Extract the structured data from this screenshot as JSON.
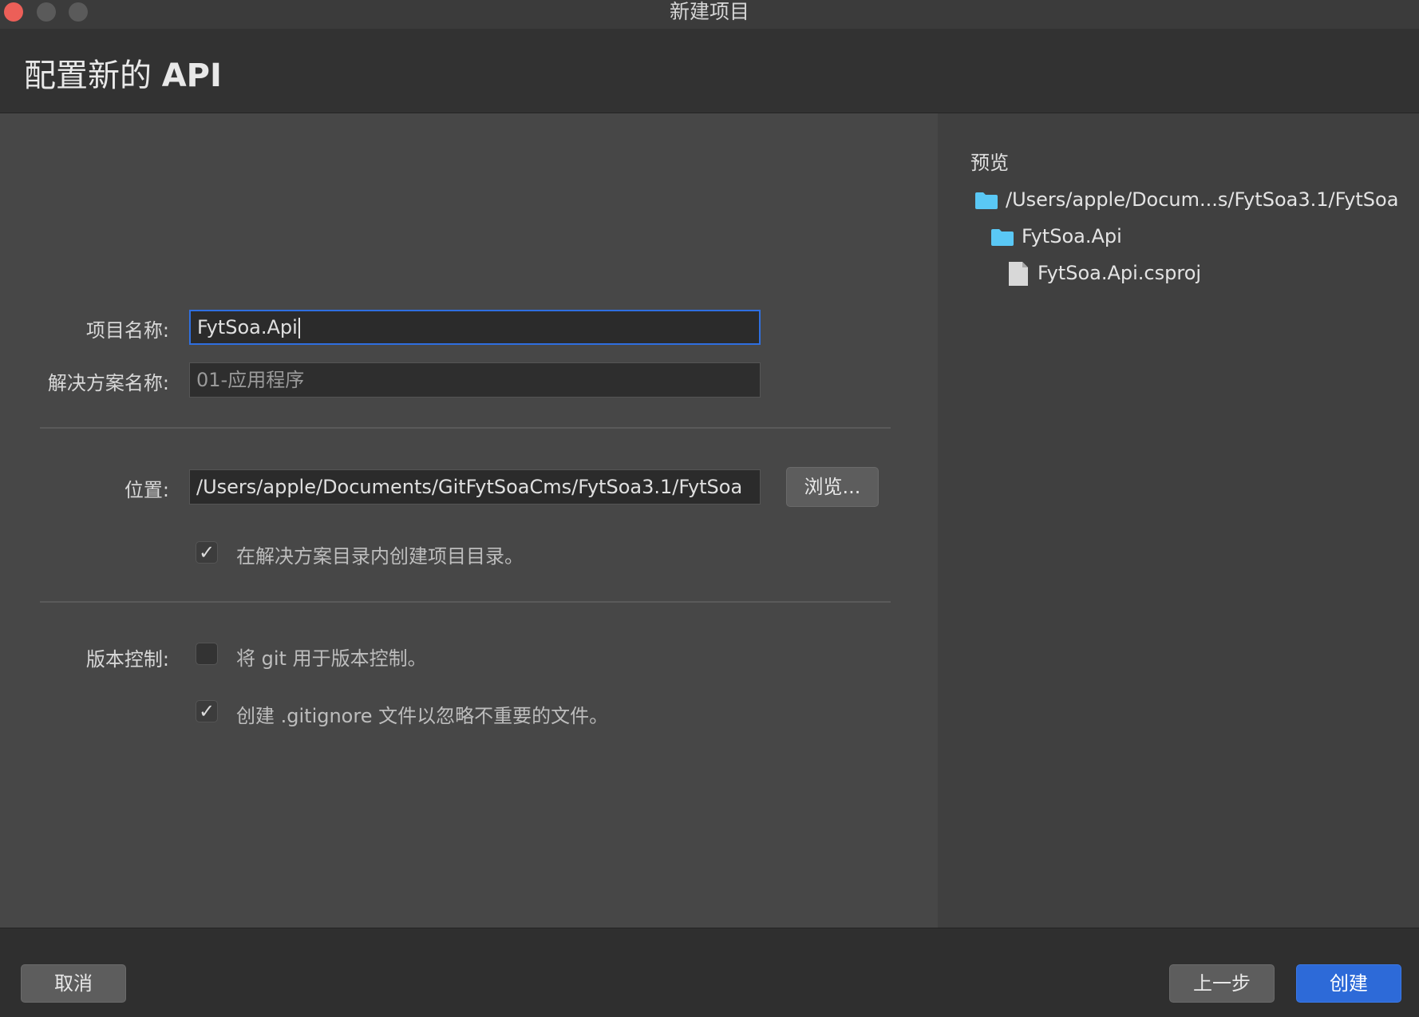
{
  "window": {
    "title": "新建项目"
  },
  "header": {
    "title_prefix": "配置新的 ",
    "title_bold": "API"
  },
  "form": {
    "project_name_label": "项目名称:",
    "project_name_value": "FytSoa.Api",
    "solution_name_label": "解决方案名称:",
    "solution_name_value": "01-应用程序",
    "location_label": "位置:",
    "location_value": "/Users/apple/Documents/GitFytSoaCms/FytSoa3.1/FytSoa",
    "browse_label": "浏览...",
    "create_dir_checked": true,
    "create_dir_label": "在解决方案目录内创建项目目录。",
    "vcs_label": "版本控制:",
    "git_checked": false,
    "git_label": "将 git 用于版本控制。",
    "gitignore_checked": true,
    "gitignore_label": "创建 .gitignore 文件以忽略不重要的文件。"
  },
  "preview": {
    "title": "预览",
    "tree": [
      {
        "label": "/Users/apple/Docum...s/FytSoa3.1/FytSoa",
        "icon": "folder-icon"
      },
      {
        "label": "FytSoa.Api",
        "icon": "folder-icon"
      },
      {
        "label": "FytSoa.Api.csproj",
        "icon": "file-icon"
      }
    ]
  },
  "footer": {
    "cancel_label": "取消",
    "back_label": "上一步",
    "create_label": "创建"
  },
  "colors": {
    "accent": "#2d6ad8",
    "folder": "#5ac8f5",
    "close": "#ec5f58"
  }
}
